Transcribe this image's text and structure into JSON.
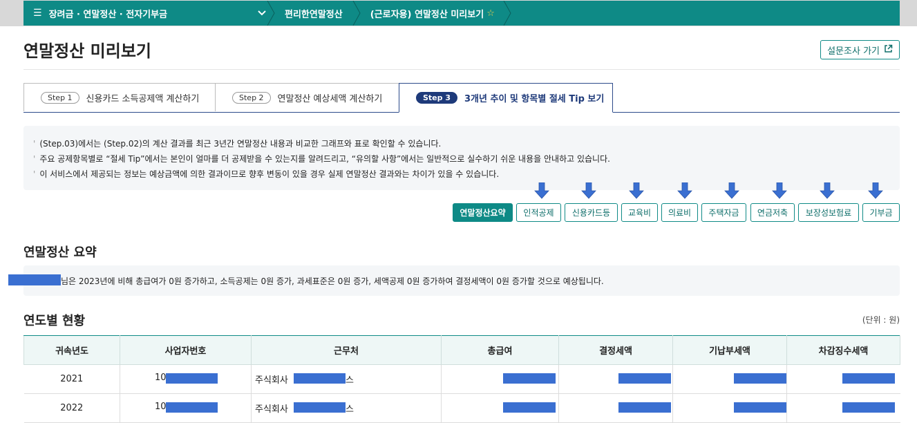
{
  "nav": {
    "menu_label": "장려금 · 연말정산 · 전자기부금",
    "crumbs": [
      "편리한연말정산",
      "(근로자용) 연말정산 미리보기"
    ]
  },
  "page": {
    "title": "연말정산 미리보기",
    "survey_label": "설문조사 가기"
  },
  "tabs": [
    {
      "step": "Step 1",
      "label": "신용카드 소득공제액 계산하기"
    },
    {
      "step": "Step 2",
      "label": "연말정산 예상세액 계산하기"
    },
    {
      "step": "Step 3",
      "label": "3개년 추이 및 항목별 절세 Tip 보기"
    }
  ],
  "info": [
    "(Step.03)에서는 (Step.02)의 계산 결과를 최근 3년간 연말정산 내용과 비교한 그래프와 표로 확인할 수 있습니다.",
    "주요 공제항목별로 “절세 Tip”에서는 본인이 얼마를 더 공제받을 수 있는지를 알려드리고, “유의할 사항”에서는 일반적으로 실수하기 쉬운 내용을 안내하고 있습니다.",
    "이 서비스에서 제공되는 정보는 예상금액에 의한 결과이므로 향후 변동이 있을 경우 실제 연말정산 결과와는 차이가 있을 수 있습니다."
  ],
  "quick_buttons": [
    "연말정산요약",
    "인적공제",
    "신용카드등",
    "교육비",
    "의료비",
    "주택자금",
    "연금저축",
    "보장성보험료",
    "기부금"
  ],
  "summary": {
    "heading": "연말정산 요약",
    "text": "님은 2023년에 비해 총급여가 0원 증가하고, 소득공제는 0원 증가, 과세표준은 0원 증가, 세액공제 0원 증가하여 결정세액이 0원 증가할 것으로 예상됩니다."
  },
  "yearly": {
    "heading": "연도별 현황",
    "unit": "(단위 : 원)",
    "columns": [
      "귀속년도",
      "사업자번호",
      "근무처",
      "총급여",
      "결정세액",
      "기납부세액",
      "차감징수세액"
    ],
    "rows": [
      {
        "year": "2021",
        "biz_prefix": "10",
        "company_prefix": "주식회사",
        "company_suffix": "스"
      },
      {
        "year": "2022",
        "biz_prefix": "10",
        "company_prefix": "주식회사",
        "company_suffix": "스"
      }
    ]
  },
  "colors": {
    "accent": "#0e8a86",
    "navy": "#1e3a7a",
    "arrow": "#3a6fd1"
  }
}
